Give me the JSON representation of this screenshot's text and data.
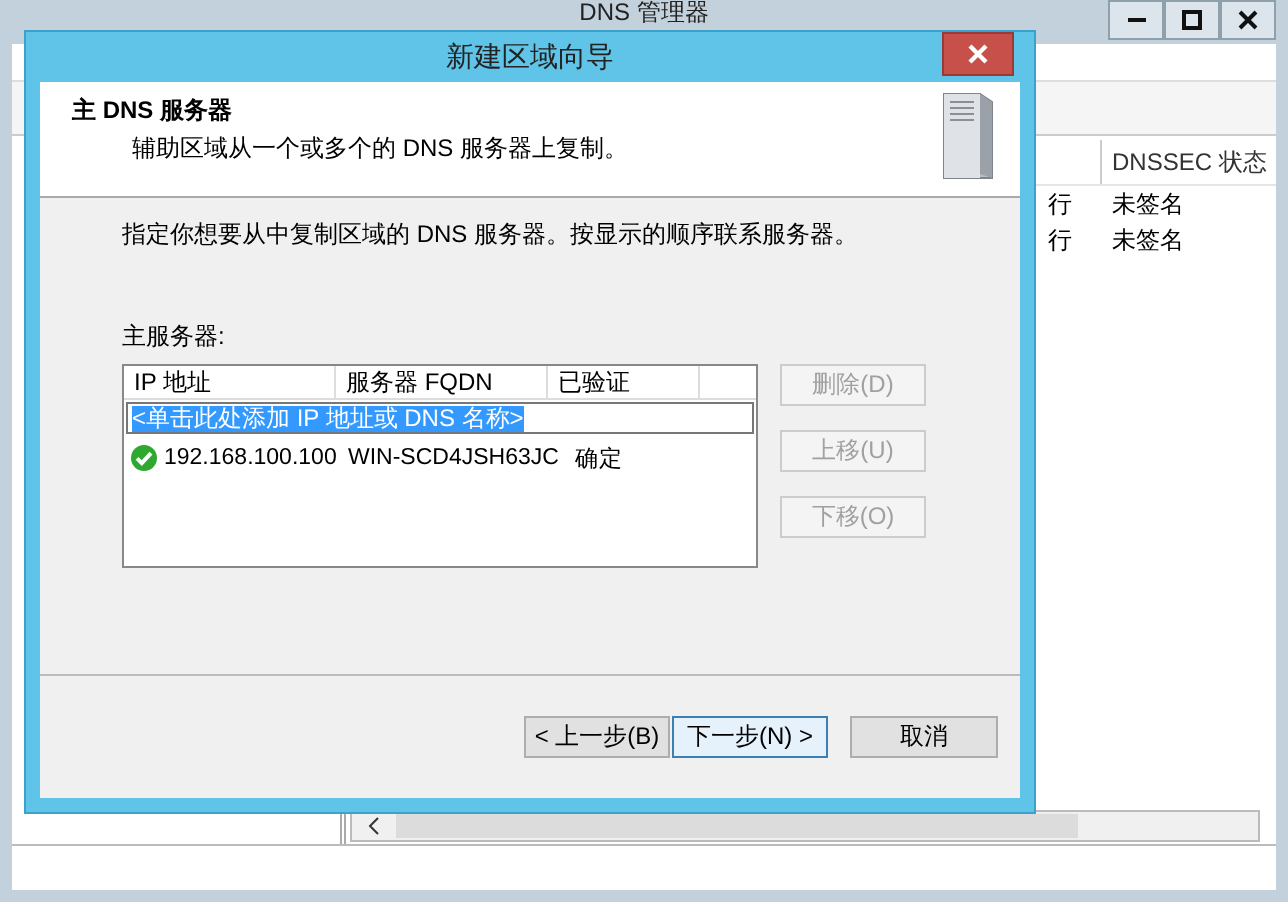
{
  "background_window": {
    "title": "DNS 管理器",
    "columns": [
      {
        "label": "DNSSEC 状态"
      }
    ],
    "rows": [
      {
        "column_1": "行",
        "dnssec_status": "未签名"
      },
      {
        "column_1": "行",
        "dnssec_status": "未签名"
      }
    ]
  },
  "dialog": {
    "title": "新建区域向导",
    "header": {
      "title": "主 DNS 服务器",
      "subtitle": "辅助区域从一个或多个的 DNS 服务器上复制。"
    },
    "instruction": "指定你想要从中复制区域的 DNS 服务器。按显示的顺序联系服务器。",
    "list_label": "主服务器:",
    "list": {
      "columns": [
        "IP 地址",
        "服务器 FQDN",
        "已验证"
      ],
      "add_entry": "<单击此处添加 IP 地址或 DNS 名称>",
      "rows": [
        {
          "ip": "192.168.100.100",
          "fqdn": "WIN-SCD4JSH63JC",
          "verified": "确定",
          "kind": "ok"
        }
      ]
    },
    "side_buttons": [
      {
        "label": "删除(D)",
        "disabled": true
      },
      {
        "label": "上移(U)",
        "disabled": true
      },
      {
        "label": "下移(O)",
        "disabled": true
      }
    ],
    "nav_buttons": [
      {
        "label": "< 上一步(B)",
        "focused": false
      },
      {
        "label": "下一步(N) >",
        "focused": true
      },
      {
        "label": "取消",
        "focused": false
      }
    ]
  }
}
